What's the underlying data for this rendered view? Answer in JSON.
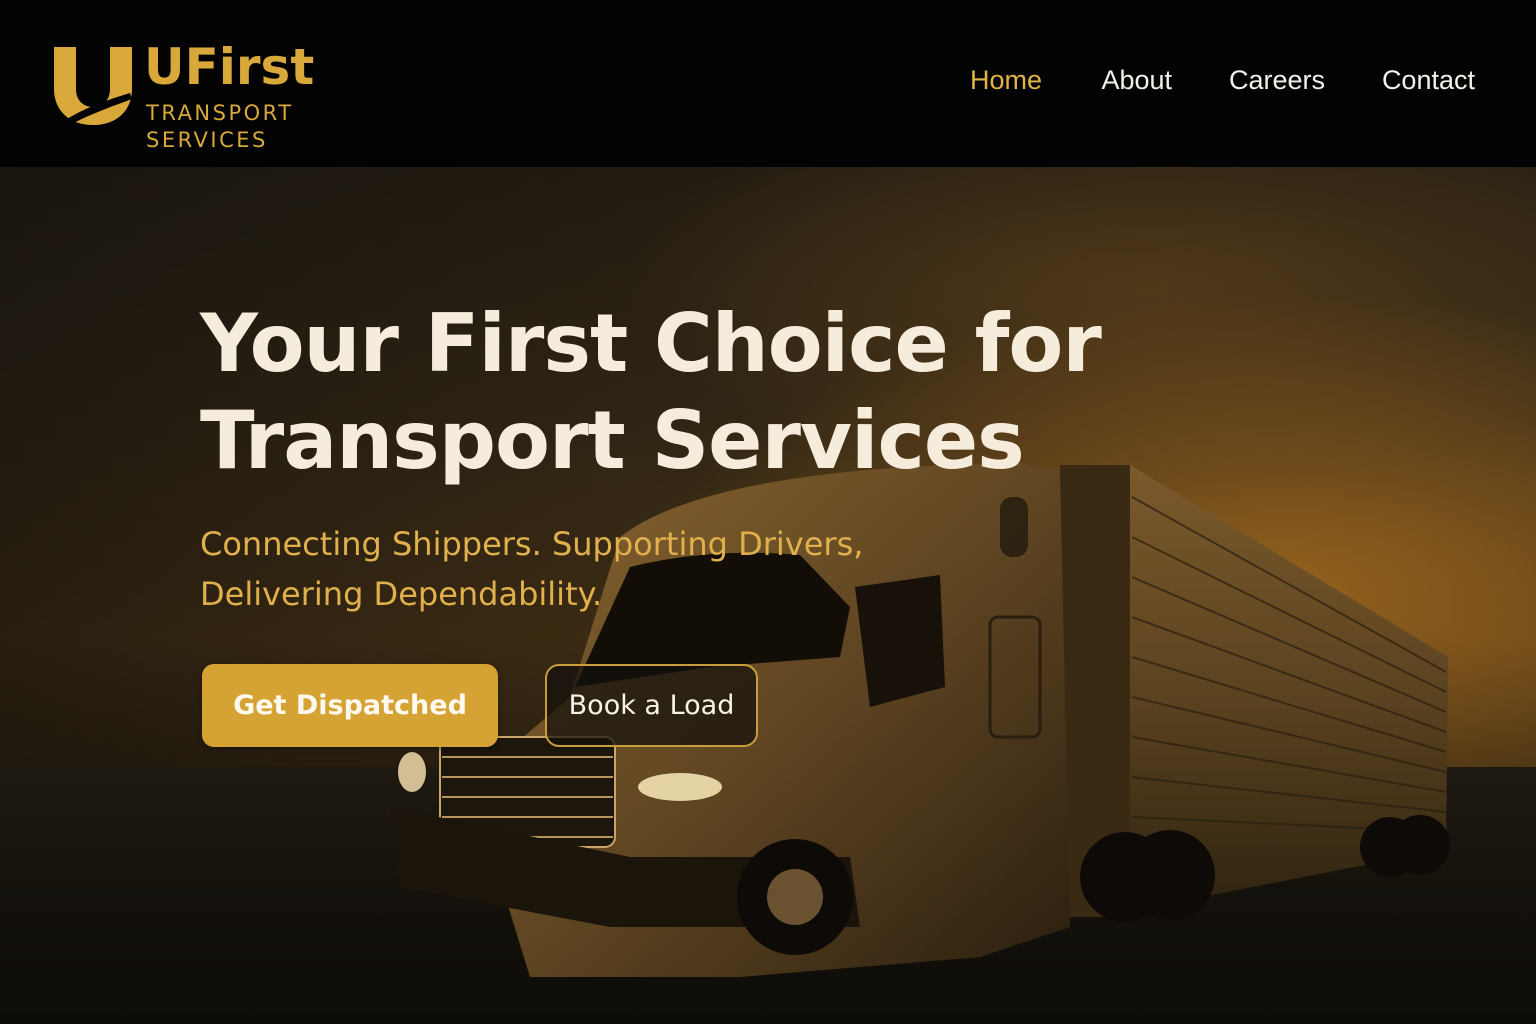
{
  "header": {
    "logo_name": "UFirst",
    "logo_tagline": "TRANSPORT\nSERVICES",
    "nav": [
      {
        "label": "Home",
        "active": true
      },
      {
        "label": "About",
        "active": false
      },
      {
        "label": "Careers",
        "active": false
      },
      {
        "label": "Contact",
        "active": false
      }
    ]
  },
  "hero": {
    "title": "Your First Choice for Transport Services",
    "subtitle": "Connecting Shippers. Supporting Drivers, Delivering Dependability.",
    "primary_button": "Get Dispatched",
    "secondary_button": "Book a Load",
    "background_image": "semi-truck-at-sunset"
  },
  "colors": {
    "brand_gold": "#d8a93a",
    "header_bg": "#030303",
    "title_text": "#f6ecdb",
    "button_gold": "#d5a234"
  },
  "icons": [
    "logo-u-icon"
  ]
}
